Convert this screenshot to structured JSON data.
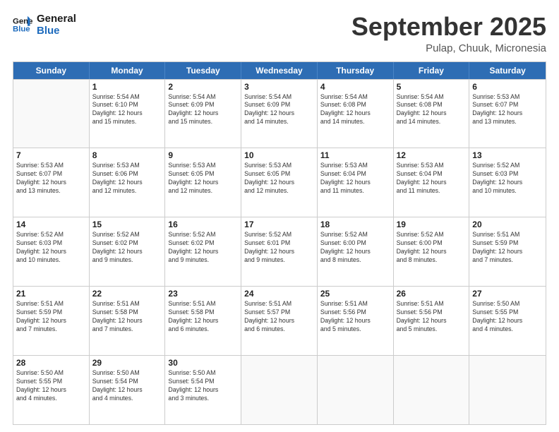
{
  "header": {
    "logo_line1": "General",
    "logo_line2": "Blue",
    "month": "September 2025",
    "location": "Pulap, Chuuk, Micronesia"
  },
  "days": [
    "Sunday",
    "Monday",
    "Tuesday",
    "Wednesday",
    "Thursday",
    "Friday",
    "Saturday"
  ],
  "weeks": [
    [
      {
        "day": "",
        "text": ""
      },
      {
        "day": "1",
        "text": "Sunrise: 5:54 AM\nSunset: 6:10 PM\nDaylight: 12 hours\nand 15 minutes."
      },
      {
        "day": "2",
        "text": "Sunrise: 5:54 AM\nSunset: 6:09 PM\nDaylight: 12 hours\nand 15 minutes."
      },
      {
        "day": "3",
        "text": "Sunrise: 5:54 AM\nSunset: 6:09 PM\nDaylight: 12 hours\nand 14 minutes."
      },
      {
        "day": "4",
        "text": "Sunrise: 5:54 AM\nSunset: 6:08 PM\nDaylight: 12 hours\nand 14 minutes."
      },
      {
        "day": "5",
        "text": "Sunrise: 5:54 AM\nSunset: 6:08 PM\nDaylight: 12 hours\nand 14 minutes."
      },
      {
        "day": "6",
        "text": "Sunrise: 5:53 AM\nSunset: 6:07 PM\nDaylight: 12 hours\nand 13 minutes."
      }
    ],
    [
      {
        "day": "7",
        "text": "Sunrise: 5:53 AM\nSunset: 6:07 PM\nDaylight: 12 hours\nand 13 minutes."
      },
      {
        "day": "8",
        "text": "Sunrise: 5:53 AM\nSunset: 6:06 PM\nDaylight: 12 hours\nand 12 minutes."
      },
      {
        "day": "9",
        "text": "Sunrise: 5:53 AM\nSunset: 6:05 PM\nDaylight: 12 hours\nand 12 minutes."
      },
      {
        "day": "10",
        "text": "Sunrise: 5:53 AM\nSunset: 6:05 PM\nDaylight: 12 hours\nand 12 minutes."
      },
      {
        "day": "11",
        "text": "Sunrise: 5:53 AM\nSunset: 6:04 PM\nDaylight: 12 hours\nand 11 minutes."
      },
      {
        "day": "12",
        "text": "Sunrise: 5:53 AM\nSunset: 6:04 PM\nDaylight: 12 hours\nand 11 minutes."
      },
      {
        "day": "13",
        "text": "Sunrise: 5:52 AM\nSunset: 6:03 PM\nDaylight: 12 hours\nand 10 minutes."
      }
    ],
    [
      {
        "day": "14",
        "text": "Sunrise: 5:52 AM\nSunset: 6:03 PM\nDaylight: 12 hours\nand 10 minutes."
      },
      {
        "day": "15",
        "text": "Sunrise: 5:52 AM\nSunset: 6:02 PM\nDaylight: 12 hours\nand 9 minutes."
      },
      {
        "day": "16",
        "text": "Sunrise: 5:52 AM\nSunset: 6:02 PM\nDaylight: 12 hours\nand 9 minutes."
      },
      {
        "day": "17",
        "text": "Sunrise: 5:52 AM\nSunset: 6:01 PM\nDaylight: 12 hours\nand 9 minutes."
      },
      {
        "day": "18",
        "text": "Sunrise: 5:52 AM\nSunset: 6:00 PM\nDaylight: 12 hours\nand 8 minutes."
      },
      {
        "day": "19",
        "text": "Sunrise: 5:52 AM\nSunset: 6:00 PM\nDaylight: 12 hours\nand 8 minutes."
      },
      {
        "day": "20",
        "text": "Sunrise: 5:51 AM\nSunset: 5:59 PM\nDaylight: 12 hours\nand 7 minutes."
      }
    ],
    [
      {
        "day": "21",
        "text": "Sunrise: 5:51 AM\nSunset: 5:59 PM\nDaylight: 12 hours\nand 7 minutes."
      },
      {
        "day": "22",
        "text": "Sunrise: 5:51 AM\nSunset: 5:58 PM\nDaylight: 12 hours\nand 7 minutes."
      },
      {
        "day": "23",
        "text": "Sunrise: 5:51 AM\nSunset: 5:58 PM\nDaylight: 12 hours\nand 6 minutes."
      },
      {
        "day": "24",
        "text": "Sunrise: 5:51 AM\nSunset: 5:57 PM\nDaylight: 12 hours\nand 6 minutes."
      },
      {
        "day": "25",
        "text": "Sunrise: 5:51 AM\nSunset: 5:56 PM\nDaylight: 12 hours\nand 5 minutes."
      },
      {
        "day": "26",
        "text": "Sunrise: 5:51 AM\nSunset: 5:56 PM\nDaylight: 12 hours\nand 5 minutes."
      },
      {
        "day": "27",
        "text": "Sunrise: 5:50 AM\nSunset: 5:55 PM\nDaylight: 12 hours\nand 4 minutes."
      }
    ],
    [
      {
        "day": "28",
        "text": "Sunrise: 5:50 AM\nSunset: 5:55 PM\nDaylight: 12 hours\nand 4 minutes."
      },
      {
        "day": "29",
        "text": "Sunrise: 5:50 AM\nSunset: 5:54 PM\nDaylight: 12 hours\nand 4 minutes."
      },
      {
        "day": "30",
        "text": "Sunrise: 5:50 AM\nSunset: 5:54 PM\nDaylight: 12 hours\nand 3 minutes."
      },
      {
        "day": "",
        "text": ""
      },
      {
        "day": "",
        "text": ""
      },
      {
        "day": "",
        "text": ""
      },
      {
        "day": "",
        "text": ""
      }
    ]
  ]
}
